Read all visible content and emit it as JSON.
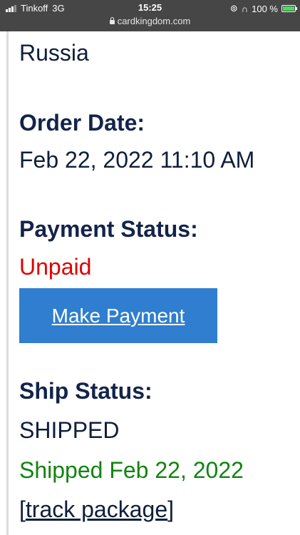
{
  "status_bar": {
    "carrier": "Tinkoff",
    "network": "3G",
    "time": "15:25",
    "url": "cardkingdom.com",
    "battery": "100 %",
    "icons": [
      "signal-icon",
      "lock-icon",
      "orientation-lock-icon",
      "headphones-icon",
      "battery-icon"
    ]
  },
  "order": {
    "country": "Russia",
    "order_date_label": "Order Date:",
    "order_date": "Feb 22, 2022 11:10 AM",
    "payment_status_label": "Payment Status:",
    "payment_status": "Unpaid",
    "make_payment_label": "Make Payment",
    "ship_status_label": "Ship Status:",
    "ship_status": "SHIPPED",
    "shipped_date": "Shipped Feb 22, 2022",
    "track_open": "[",
    "track_link": "track package",
    "track_close": "]"
  },
  "colors": {
    "status_bar_bg": "#464646",
    "heading": "#13244a",
    "unpaid": "#e00000",
    "shipped": "#118411",
    "button": "#2f7ecf"
  }
}
